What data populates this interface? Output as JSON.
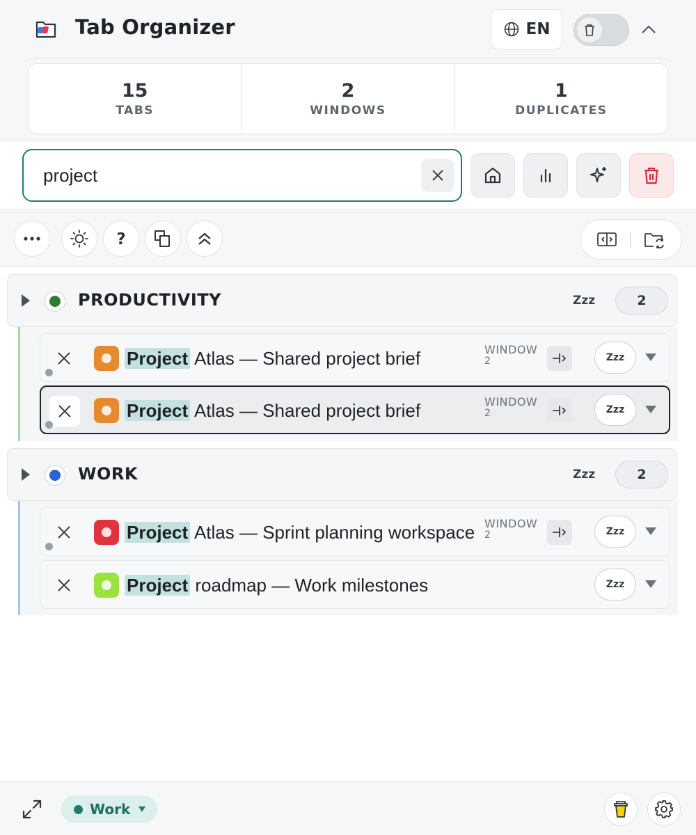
{
  "app": {
    "title": "Tab Organizer"
  },
  "header": {
    "language": "EN"
  },
  "stats": [
    {
      "value": "15",
      "label": "TABS"
    },
    {
      "value": "2",
      "label": "WINDOWS"
    },
    {
      "value": "1",
      "label": "DUPLICATES"
    }
  ],
  "search": {
    "query": "project"
  },
  "groups": [
    {
      "name": "PRODUCTIVITY",
      "color": "#2e7d32",
      "accent": "#a8d5a8",
      "zzz": "Zzz",
      "count": "2",
      "tabs": [
        {
          "highlight": "Project",
          "rest": " Atlas — Shared project brief",
          "window_label": "WINDOW",
          "window_num": "2",
          "favicon_color": "#e58a2e",
          "zzz": "Zzz",
          "active": false
        },
        {
          "highlight": "Project",
          "rest": " Atlas — Shared project brief",
          "window_label": "WINDOW",
          "window_num": "2",
          "favicon_color": "#e58a2e",
          "zzz": "Zzz",
          "active": true
        }
      ]
    },
    {
      "name": "WORK",
      "color": "#2962d9",
      "accent": "#a9c3f0",
      "zzz": "Zzz",
      "count": "2",
      "tabs": [
        {
          "highlight": "Project",
          "rest": " Atlas — Sprint planning workspace",
          "window_label": "WINDOW",
          "window_num": "2",
          "favicon_color": "#e0333c",
          "zzz": "Zzz",
          "active": false
        },
        {
          "highlight": "Project",
          "rest": " roadmap — Work milestones",
          "window_label": "",
          "window_num": "",
          "favicon_color": "#9be23c",
          "zzz": "Zzz",
          "active": false
        }
      ]
    }
  ],
  "footer": {
    "space": "Work"
  }
}
